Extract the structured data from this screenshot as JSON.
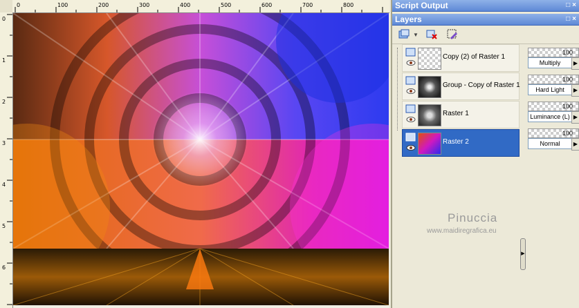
{
  "ruler": {
    "top_labels": [
      "0",
      "100",
      "200",
      "300",
      "400",
      "500",
      "600",
      "700",
      "800"
    ],
    "left_labels": [
      "0",
      "1",
      "2",
      "3",
      "4",
      "5",
      "6"
    ]
  },
  "panels": {
    "script_output": {
      "title": "Script Output"
    },
    "layers": {
      "title": "Layers",
      "items": [
        {
          "name": "Copy (2) of Raster 1",
          "opacity": "100",
          "blend": "Multiply",
          "selected": false
        },
        {
          "name": "Group - Copy of Raster 1",
          "opacity": "100",
          "blend": "Hard Light",
          "selected": false
        },
        {
          "name": "Raster 1",
          "opacity": "100",
          "blend": "Luminance (L)",
          "selected": false
        },
        {
          "name": "Raster 2",
          "opacity": "100",
          "blend": "Normal",
          "selected": true
        }
      ]
    }
  },
  "watermark": {
    "name": "Pinuccia",
    "url": "www.maidiregrafica.eu"
  },
  "colors": {
    "selection": "#316ac5",
    "title_bar": "#5e89d6"
  }
}
